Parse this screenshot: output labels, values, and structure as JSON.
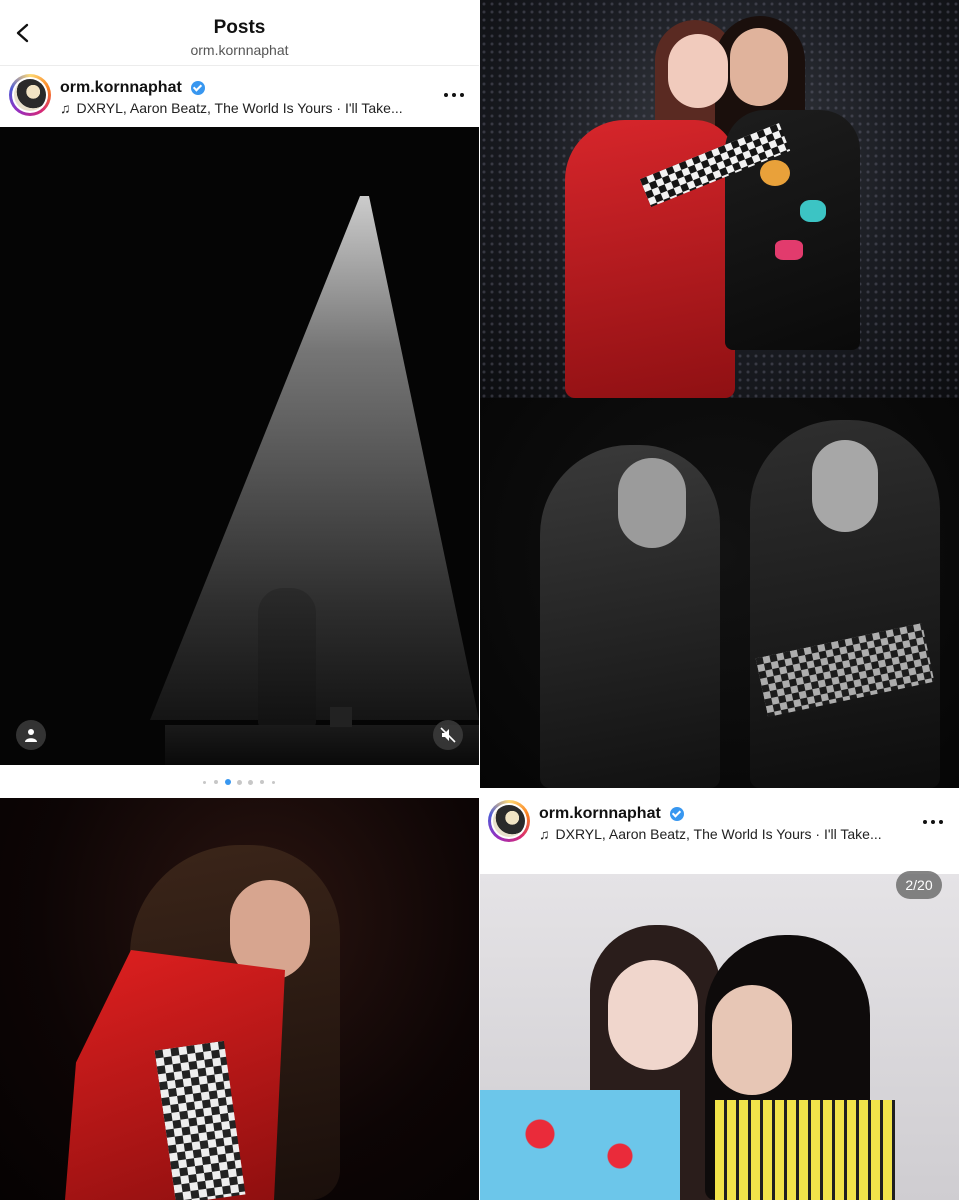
{
  "header": {
    "title": "Posts",
    "subtitle": "orm.kornnaphat"
  },
  "posts": [
    {
      "username": "orm.kornnaphat",
      "verified": true,
      "music": "DXRYL, Aaron Beatz, The World Is Yours · I'll Take..."
    },
    {
      "username": "orm.kornnaphat",
      "verified": true,
      "music": "DXRYL, Aaron Beatz, The World Is Yours · I'll Take..."
    }
  ],
  "carousel": {
    "total_dots": 7,
    "active_dot": 3
  },
  "media_counter": "2/20",
  "colors": {
    "verified": "#3897f0",
    "active_dot": "#3897f0",
    "inactive_dot": "#c7c7c7"
  },
  "icons": [
    "back-chevron-icon",
    "verified-badge-icon",
    "music-note-icon",
    "more-options-icon",
    "tagged-people-icon",
    "mute-icon"
  ]
}
